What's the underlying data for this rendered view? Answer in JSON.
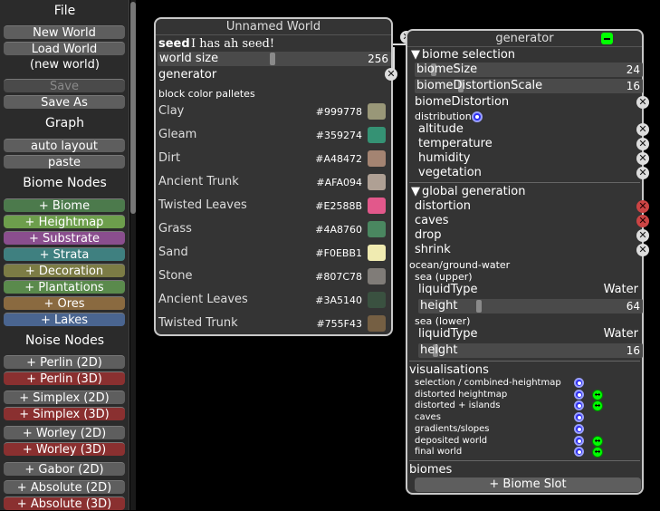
{
  "sidebar": {
    "file_heading": "File",
    "new_world": "New World",
    "load_world": "Load World",
    "current_world": "(new world)",
    "save": "Save",
    "save_as": "Save As",
    "graph_heading": "Graph",
    "auto_layout": "auto layout",
    "paste": "paste",
    "biome_nodes_heading": "Biome Nodes",
    "biome_nodes": [
      {
        "label": "+ Biome",
        "color": "#4c7a4c"
      },
      {
        "label": "+ Heightmap",
        "color": "#6d9e4c"
      },
      {
        "label": "+ Substrate",
        "color": "#8a4e8e"
      },
      {
        "label": "+ Strata",
        "color": "#3f8080"
      },
      {
        "label": "+ Decoration",
        "color": "#7c7c45"
      },
      {
        "label": "+ Plantations",
        "color": "#5a8a4c"
      },
      {
        "label": "+ Ores",
        "color": "#8a6a40"
      },
      {
        "label": "+ Lakes",
        "color": "#4a6590"
      }
    ],
    "noise_nodes_heading": "Noise Nodes",
    "noise_nodes": [
      {
        "label": "+ Perlin (2D)",
        "color": "#5e5e5e"
      },
      {
        "label": "+ Perlin (3D)",
        "color": "#8a3030"
      },
      {
        "label": "+ Simplex (2D)",
        "color": "#5e5e5e"
      },
      {
        "label": "+ Simplex (3D)",
        "color": "#8a3030"
      },
      {
        "label": "+ Worley (2D)",
        "color": "#5e5e5e"
      },
      {
        "label": "+ Worley (3D)",
        "color": "#8a3030"
      },
      {
        "label": "+ Gabor (2D)",
        "color": "#5e5e5e"
      },
      {
        "label": "+ Absolute (2D)",
        "color": "#5e5e5e"
      },
      {
        "label": "+ Absolute (3D)",
        "color": "#8a3030"
      }
    ]
  },
  "world": {
    "title": "Unnamed World",
    "seed_label": "seed",
    "seed_value": "I has ah seed!",
    "size_label": "world size",
    "size_value": "256",
    "generator_label": "generator",
    "palettes_label": "block color palletes",
    "palettes": [
      {
        "name": "Clay",
        "hex": "#999778"
      },
      {
        "name": "Gleam",
        "hex": "#359274"
      },
      {
        "name": "Dirt",
        "hex": "#A48472"
      },
      {
        "name": "Ancient Trunk",
        "hex": "#AFA094"
      },
      {
        "name": "Twisted Leaves",
        "hex": "#E2588B"
      },
      {
        "name": "Grass",
        "hex": "#4A8760"
      },
      {
        "name": "Sand",
        "hex": "#F0EBB1"
      },
      {
        "name": "Stone",
        "hex": "#807C78"
      },
      {
        "name": "Ancient Leaves",
        "hex": "#3A5140"
      },
      {
        "name": "Twisted Trunk",
        "hex": "#755F43"
      }
    ]
  },
  "generator": {
    "title": "generator",
    "biome_selection": "biome selection",
    "biome_size_label": "biomeSize",
    "biome_size_value": "24",
    "distortion_scale_label": "biomeDistortionScale",
    "distortion_scale_value": "16",
    "biome_distortion": "biomeDistortion",
    "distribution": "distribution",
    "dist_inputs": [
      "altitude",
      "temperature",
      "humidity",
      "vegetation"
    ],
    "global_generation": "global generation",
    "global_inputs": [
      {
        "label": "distortion",
        "connected": true
      },
      {
        "label": "caves",
        "connected": true
      },
      {
        "label": "drop",
        "connected": false
      },
      {
        "label": "shrink",
        "connected": false
      }
    ],
    "ocean_label": "ocean/ground-water",
    "sea_upper": "sea (upper)",
    "liquid_type_label": "liquidType",
    "liquid_upper_value": "Water",
    "height_label": "height",
    "height_upper_value": "64",
    "sea_lower": "sea (lower)",
    "liquid_lower_value": "Water",
    "height_lower_value": "16",
    "visualisations_label": "visualisations",
    "visualisations": [
      {
        "label": "selection / combined-heightmap",
        "arrows": false
      },
      {
        "label": "distorted heightmap",
        "arrows": true
      },
      {
        "label": "distorted + islands",
        "arrows": true
      },
      {
        "label": "caves",
        "arrows": false
      },
      {
        "label": "gradients/slopes",
        "arrows": false
      },
      {
        "label": "deposited world",
        "arrows": true
      },
      {
        "label": "final world",
        "arrows": true
      }
    ],
    "biomes_label": "biomes",
    "biome_slot": "+ Biome Slot"
  }
}
